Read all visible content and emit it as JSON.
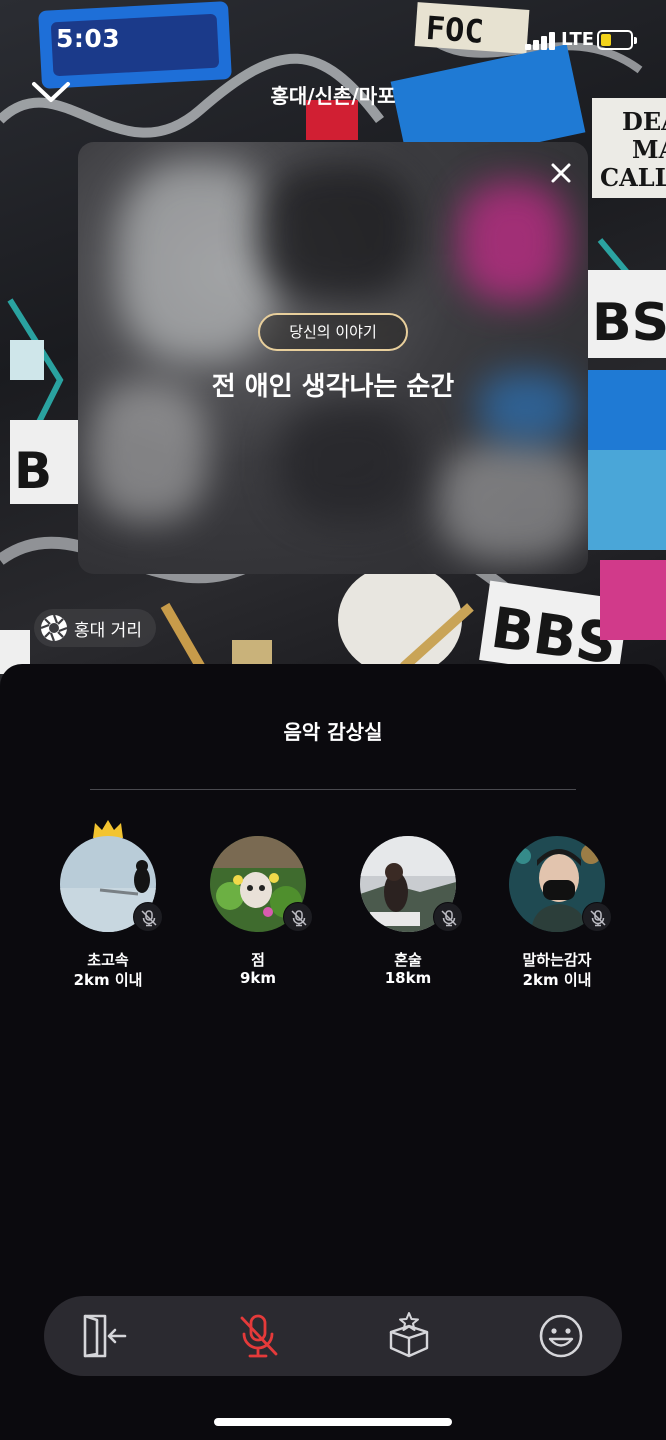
{
  "status_bar": {
    "time": "5:03",
    "network": "LTE",
    "battery_color": "#f2d21a"
  },
  "header": {
    "back_icon": "chevron-down-icon",
    "region_title": "홍대/신촌/마포"
  },
  "story": {
    "tag": "당신의 이야기",
    "title": "전 애인 생각나는 순간",
    "close_icon": "close-icon",
    "pill_border_color": "#e8cf9c"
  },
  "location_chip": {
    "icon": "camera-aperture-icon",
    "label": "홍대 거리"
  },
  "room": {
    "title": "음악 감상실"
  },
  "members": [
    {
      "name": "초고속",
      "distance": "2km 이내",
      "host": true,
      "muted": true,
      "host_icon": "crown-icon"
    },
    {
      "name": "점",
      "distance": "9km",
      "host": false,
      "muted": true
    },
    {
      "name": "혼술",
      "distance": "18km",
      "host": false,
      "muted": true
    },
    {
      "name": "말하는감자",
      "distance": "2km 이내",
      "host": false,
      "muted": true
    }
  ],
  "toolbar": {
    "items": [
      {
        "icon": "exit-room-icon",
        "state": "default"
      },
      {
        "icon": "microphone-muted-icon",
        "state": "muted",
        "color": "#e53a3a"
      },
      {
        "icon": "gift-box-icon",
        "state": "default"
      },
      {
        "icon": "emoji-smile-icon",
        "state": "default"
      }
    ]
  }
}
